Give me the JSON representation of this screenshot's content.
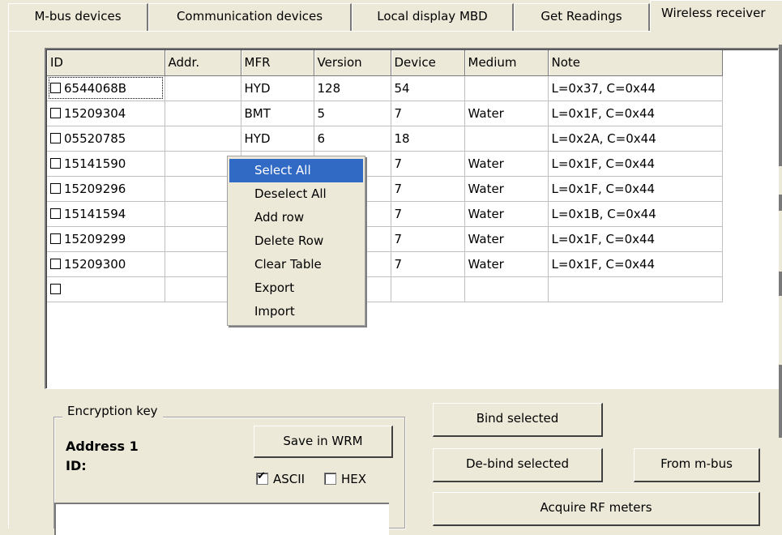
{
  "tabs": [
    {
      "label": "M-bus devices"
    },
    {
      "label": "Communication devices"
    },
    {
      "label": "Local display MBD"
    },
    {
      "label": "Get Readings"
    },
    {
      "label": "Wireless receiver"
    }
  ],
  "table": {
    "columns": [
      "ID",
      "Addr.",
      "MFR",
      "Version",
      "Device",
      "Medium",
      "Note"
    ],
    "rows": [
      {
        "id": "6544068B",
        "addr": "",
        "mfr": "HYD",
        "version": "128",
        "device": "54",
        "medium": "",
        "note": "L=0x37, C=0x44"
      },
      {
        "id": "15209304",
        "addr": "",
        "mfr": "BMT",
        "version": "5",
        "device": "7",
        "medium": "Water",
        "note": "L=0x1F, C=0x44"
      },
      {
        "id": "05520785",
        "addr": "",
        "mfr": "HYD",
        "version": "6",
        "device": "18",
        "medium": "",
        "note": "L=0x2A, C=0x44"
      },
      {
        "id": "15141590",
        "addr": "",
        "mfr": "",
        "version": "",
        "device": "7",
        "medium": "Water",
        "note": "L=0x1F, C=0x44"
      },
      {
        "id": "15209296",
        "addr": "",
        "mfr": "",
        "version": "",
        "device": "7",
        "medium": "Water",
        "note": "L=0x1F, C=0x44"
      },
      {
        "id": "15141594",
        "addr": "",
        "mfr": "",
        "version": "",
        "device": "7",
        "medium": "Water",
        "note": "L=0x1B, C=0x44"
      },
      {
        "id": "15209299",
        "addr": "",
        "mfr": "",
        "version": "",
        "device": "7",
        "medium": "Water",
        "note": "L=0x1F, C=0x44"
      },
      {
        "id": "15209300",
        "addr": "",
        "mfr": "",
        "version": "",
        "device": "7",
        "medium": "Water",
        "note": "L=0x1F, C=0x44"
      },
      {
        "id": "",
        "addr": "",
        "mfr": "",
        "version": "",
        "device": "",
        "medium": "",
        "note": ""
      }
    ]
  },
  "context_menu": {
    "items": [
      "Select All",
      "Deselect All",
      "Add row",
      "Delete Row",
      "Clear Table",
      "Export",
      "Import"
    ],
    "highlighted": "Select All"
  },
  "encryption": {
    "legend": "Encryption key",
    "address_label": "Address 1",
    "id_label": "ID:",
    "save_button": "Save in WRM",
    "ascii_label": "ASCII",
    "ascii_checked": true,
    "hex_label": "HEX",
    "hex_checked": false
  },
  "buttons": {
    "bind_selected": "Bind selected",
    "debind_selected": "De-bind selected",
    "from_mbus": "From m-bus",
    "acquire_rf": "Acquire RF meters"
  },
  "colors": {
    "background": "#ECE9D8",
    "menu_highlight": "#316AC5"
  }
}
